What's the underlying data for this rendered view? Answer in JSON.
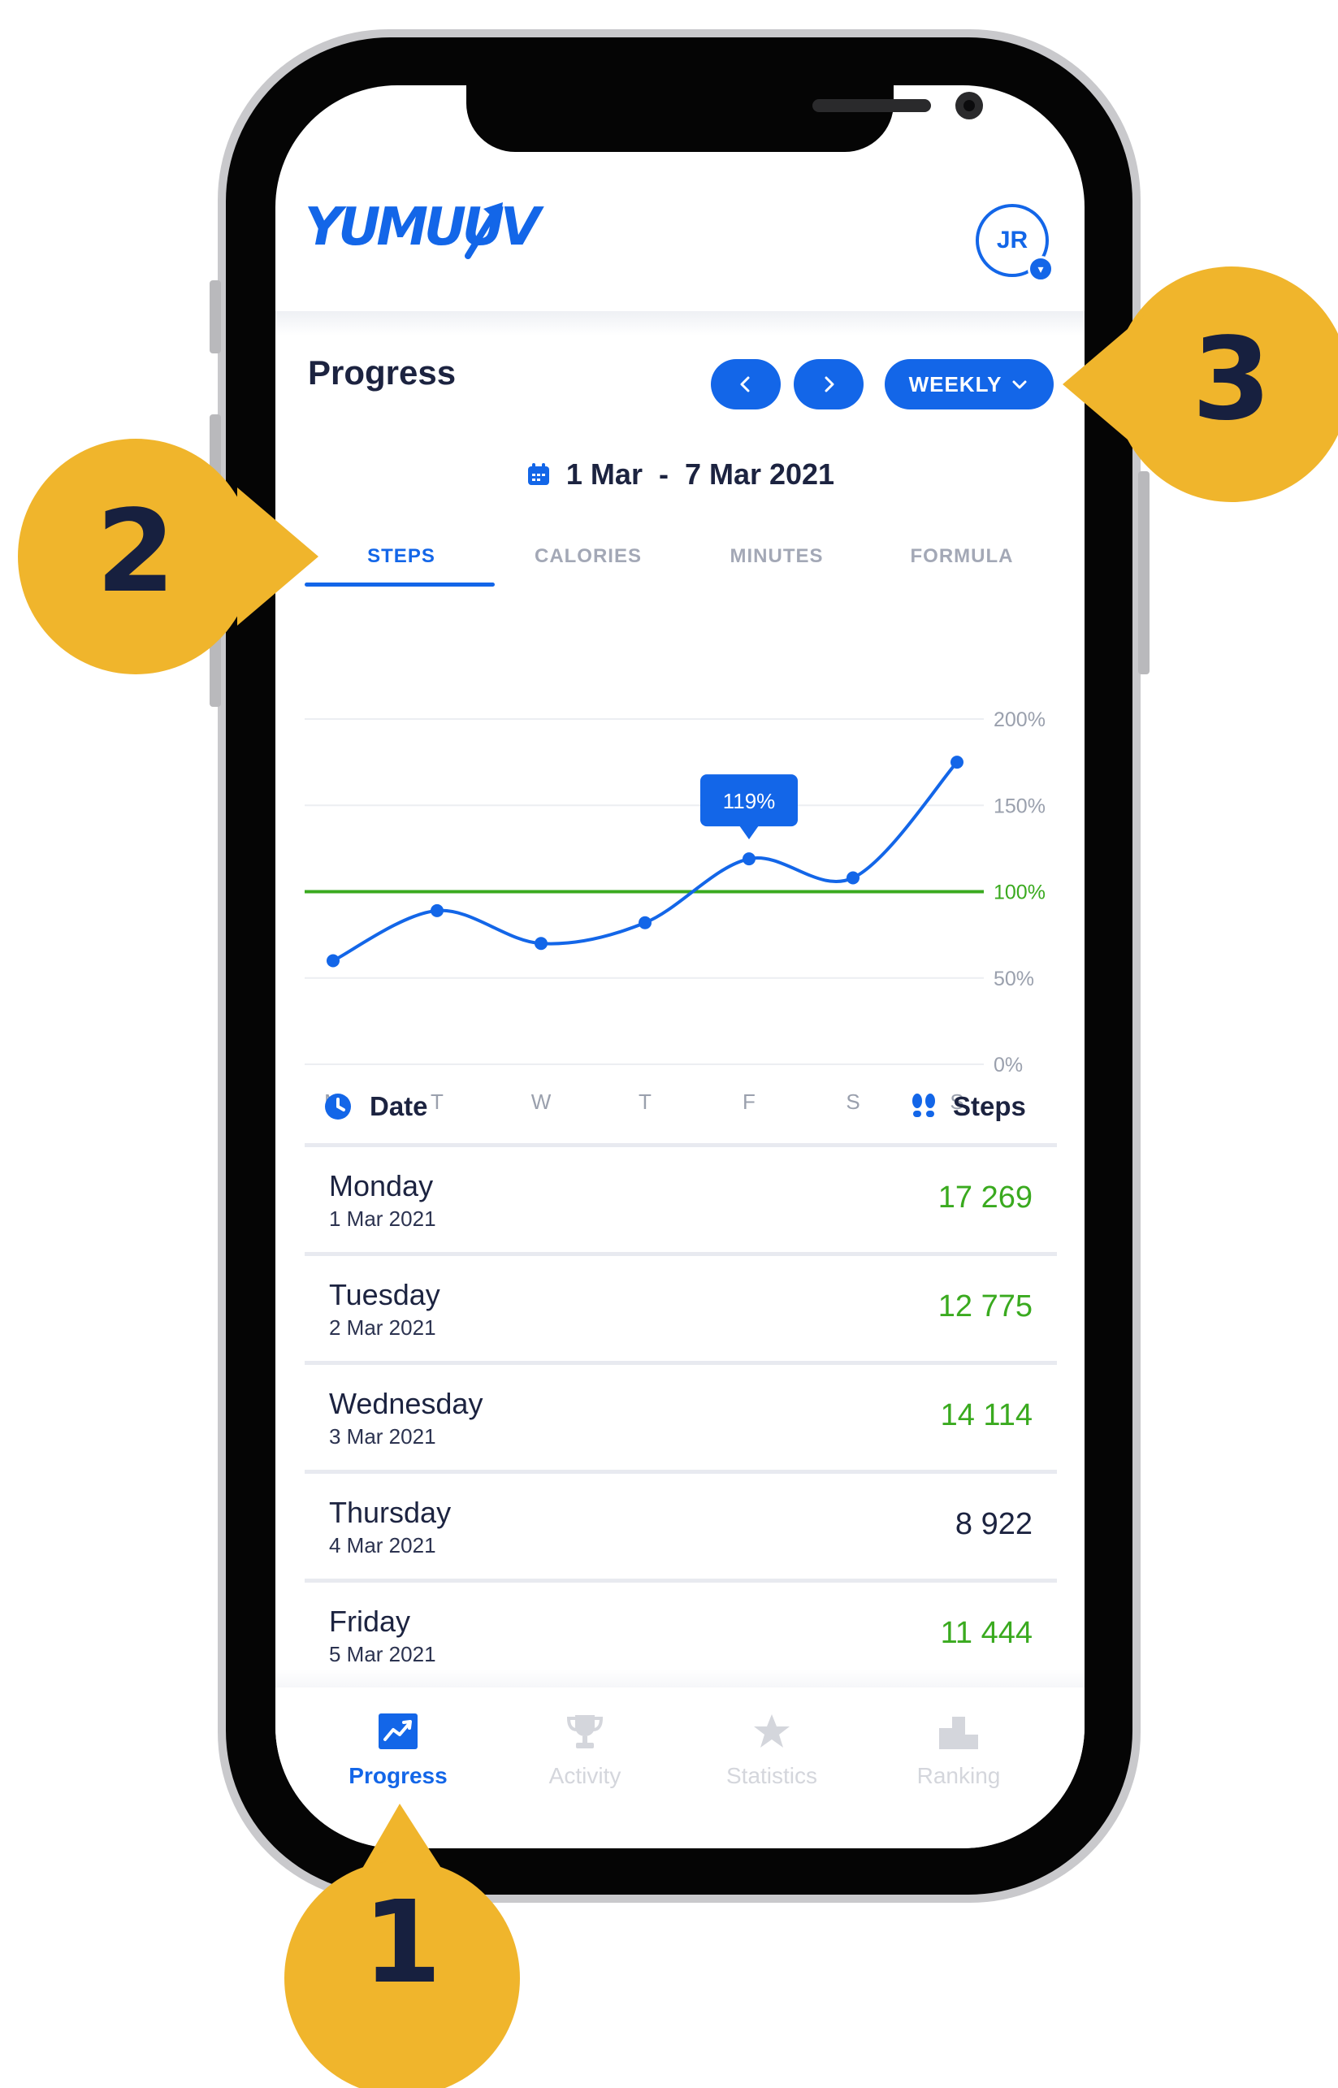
{
  "app": {
    "logo_text": "YUMUUV",
    "avatar_initials": "JR",
    "page_title": "Progress",
    "period_label": "WEEKLY",
    "date_range": "1 Mar  -  7 Mar 2021"
  },
  "tabs": [
    "STEPS",
    "CALORIES",
    "MINUTES",
    "FORMULA"
  ],
  "active_tab": "STEPS",
  "chart_data": {
    "type": "line",
    "x": [
      "M",
      "T",
      "W",
      "T",
      "F",
      "S",
      "S"
    ],
    "series": [
      {
        "values": [
          60,
          89,
          70,
          82,
          119,
          108,
          175
        ]
      }
    ],
    "y_tick_labels": [
      "200%",
      "150%",
      "100%",
      "50%",
      "0%"
    ],
    "ylim": [
      0,
      200
    ],
    "reference_line": 100,
    "tooltip": {
      "index": 4,
      "label": "119%"
    },
    "colors": {
      "line": "#1366e8",
      "reference": "#3aaa1f",
      "grid": "#eceef2"
    }
  },
  "list": {
    "date_header": "Date",
    "steps_header": "Steps",
    "rows": [
      {
        "day": "Monday",
        "date": "1 Mar 2021",
        "steps": "17 269",
        "goal_met": true
      },
      {
        "day": "Tuesday",
        "date": "2 Mar 2021",
        "steps": "12 775",
        "goal_met": true
      },
      {
        "day": "Wednesday",
        "date": "3 Mar 2021",
        "steps": "14 114",
        "goal_met": true
      },
      {
        "day": "Thursday",
        "date": "4 Mar 2021",
        "steps": "8 922",
        "goal_met": false
      },
      {
        "day": "Friday",
        "date": "5 Mar 2021",
        "steps": "11 444",
        "goal_met": true
      }
    ]
  },
  "bottom_nav": [
    {
      "label": "Progress",
      "icon": "chart-icon",
      "active": true
    },
    {
      "label": "Activity",
      "icon": "trophy-icon",
      "active": false
    },
    {
      "label": "Statistics",
      "icon": "star-icon",
      "active": false
    },
    {
      "label": "Ranking",
      "icon": "podium-icon",
      "active": false
    }
  ],
  "callouts": [
    "1",
    "2",
    "3"
  ],
  "colors": {
    "primary": "#1366e8",
    "text": "#1c2340",
    "goal": "#3aaa1f",
    "callout": "#f0b52c"
  }
}
